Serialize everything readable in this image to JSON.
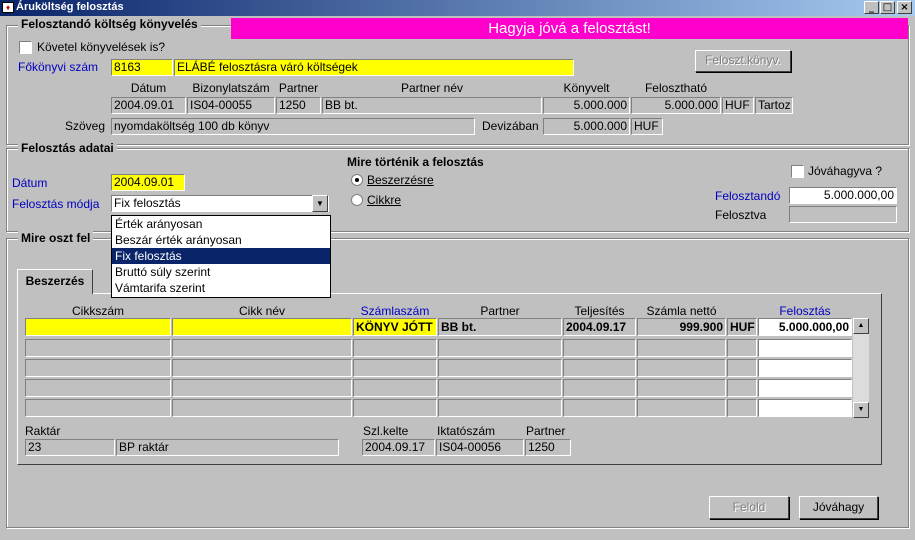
{
  "window": {
    "title": "Áruköltség felosztás",
    "min": "_",
    "max": "□",
    "close": "×"
  },
  "banner": "Hagyja jóvá a felosztást!",
  "section1": {
    "title": "Felosztandó költség könyvelés",
    "kovetel_label": "Követel könyvelések is?",
    "fokonyvi_label": "Főkönyvi szám",
    "fokonyvi_value": "8163",
    "fokonyvi_desc": "ELÁBÉ felosztásra váró költségek",
    "feloszt_button": "Feloszt.könyv.",
    "headers": {
      "datum": "Dátum",
      "bizonylat": "Bizonylatszám",
      "partner": "Partner",
      "partner_nev": "Partner név",
      "konyvelt": "Könyvelt",
      "feloszthato": "Felosztható"
    },
    "row": {
      "datum": "2004.09.01",
      "bizonylat": "IS04-00055",
      "partner": "1250",
      "partner_nev": "BB bt.",
      "konyvelt": "5.000.000",
      "feloszthato": "5.000.000",
      "currency": "HUF",
      "side": "Tartoz"
    },
    "szoveg_label": "Szöveg",
    "szoveg_value": "nyomdaköltség 100 db könyv",
    "devizaban_label": "Devizában",
    "devizaban_value": "5.000.000",
    "devizaban_currency": "HUF"
  },
  "section2": {
    "title": "Felosztás adatai",
    "datum_label": "Dátum",
    "datum_value": "2004.09.01",
    "modja_label": "Felosztás módja",
    "modja_value": "Fix felosztás",
    "options": [
      "Érték arányosan",
      "Beszár érték arányosan",
      "Fix felosztás",
      "Bruttó súly szerint",
      "Vámtarifa szerint"
    ],
    "selected_option": 2,
    "mire_title": "Mire történik a felosztás",
    "radio_beszerzes": "Beszerzésre",
    "radio_cikkre": "Cikkre",
    "jovahagyva_label": "Jóváhagyva ?",
    "felosztando_label": "Felosztandó",
    "felosztando_value": "5.000.000,00",
    "felosztva_label": "Felosztva",
    "felosztva_value": ""
  },
  "section3": {
    "title": "Mire oszt fel"
  },
  "tab": {
    "label": "Beszerzés"
  },
  "grid": {
    "headers": {
      "cikkszam": "Cikkszám",
      "cikknev": "Cikk név",
      "szamlaszam": "Számlaszám",
      "partner": "Partner",
      "teljesites": "Teljesítés",
      "szamla_netto": "Számla nettó",
      "felosztas": "Felosztás"
    },
    "row1": {
      "cikkszam": "",
      "cikknev": "",
      "szamlaszam": "KÖNYV JÓTT",
      "partner": "BB bt.",
      "teljesites": "2004.09.17",
      "szamla_netto": "999.900",
      "currency": "HUF",
      "felosztas": "5.000.000,00"
    }
  },
  "footer": {
    "raktar_label": "Raktár",
    "raktar_code": "23",
    "raktar_name": "BP raktár",
    "szlkelte_label": "Szl.kelte",
    "szlkelte_value": "2004.09.17",
    "iktato_label": "Iktatószám",
    "iktato_value": "IS04-00056",
    "partner_label": "Partner",
    "partner_value": "1250"
  },
  "buttons": {
    "feloldas": "Felold",
    "jovahagy": "Jóváhagy"
  }
}
